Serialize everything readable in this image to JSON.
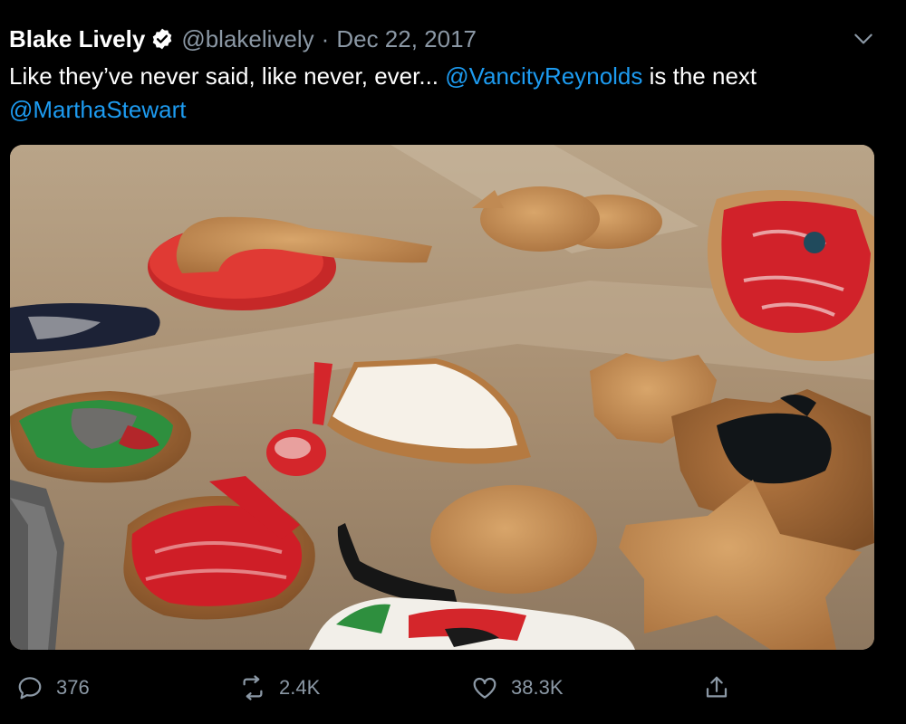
{
  "tweet": {
    "author_name": "Blake Lively",
    "handle": "@blakelively",
    "separator": "·",
    "date": "Dec 22, 2017",
    "text_part1": "Like they’ve never said, like never, ever... ",
    "mention1": "@VancityReynolds",
    "text_part2": " is the next ",
    "mention2": "@MarthaStewart"
  },
  "actions": {
    "replies": "376",
    "retweets": "2.4K",
    "likes": "38.3K"
  },
  "icons": {
    "verified": "verified-badge-icon",
    "more": "chevron-down-icon",
    "reply": "reply-icon",
    "retweet": "retweet-icon",
    "like": "heart-icon",
    "share": "share-icon"
  },
  "colors": {
    "background": "#000000",
    "text": "#ffffff",
    "secondary": "#8b98a5",
    "link": "#1d9bf0"
  }
}
